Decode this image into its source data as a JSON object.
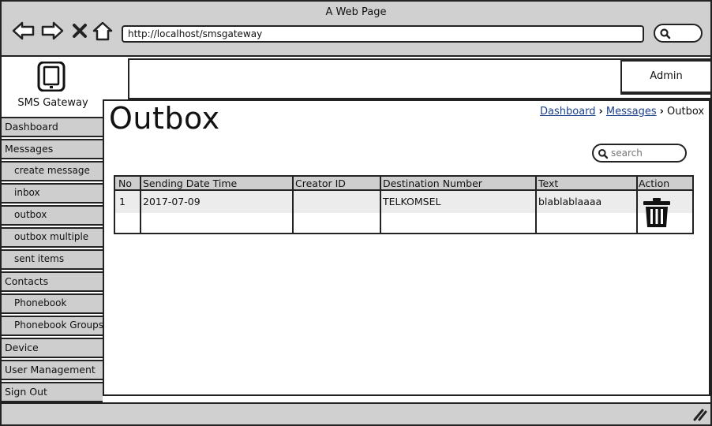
{
  "window": {
    "title": "A Web Page",
    "url": "http://localhost/smsgateway"
  },
  "brand": {
    "icon": "smartphone-icon",
    "name": "SMS Gateway"
  },
  "header": {
    "admin_label": "Admin"
  },
  "sidebar": {
    "items": [
      {
        "label": "Dashboard",
        "level": 0
      },
      {
        "label": "Messages",
        "level": 0
      },
      {
        "label": "create message",
        "level": 1
      },
      {
        "label": "inbox",
        "level": 1
      },
      {
        "label": "outbox",
        "level": 1
      },
      {
        "label": "outbox multiple",
        "level": 1
      },
      {
        "label": "sent items",
        "level": 1
      },
      {
        "label": "Contacts",
        "level": 0
      },
      {
        "label": "Phonebook",
        "level": 1
      },
      {
        "label": "Phonebook Groups",
        "level": 1
      },
      {
        "label": "Device",
        "level": 0
      },
      {
        "label": "User Management",
        "level": 0
      },
      {
        "label": "Sign Out",
        "level": 0
      }
    ]
  },
  "main": {
    "title": "Outbox",
    "breadcrumb": [
      "Dashboard",
      "Messages",
      "Outbox"
    ],
    "search": {
      "placeholder": "search"
    },
    "table": {
      "columns": [
        "No",
        "Sending Date Time",
        "Creator ID",
        "Destination Number",
        "Text",
        "Action"
      ],
      "rows": [
        {
          "no": "1",
          "sending_date_time": "2017-07-09",
          "creator_id": "",
          "destination_number": "TELKOMSEL",
          "text": "blablablaaaa",
          "action_icon": "trash-icon"
        }
      ]
    }
  },
  "colors": {
    "chrome": "#d0d0d0",
    "nav_item": "#cecece",
    "link": "#1a3e8c",
    "border": "#222222"
  }
}
